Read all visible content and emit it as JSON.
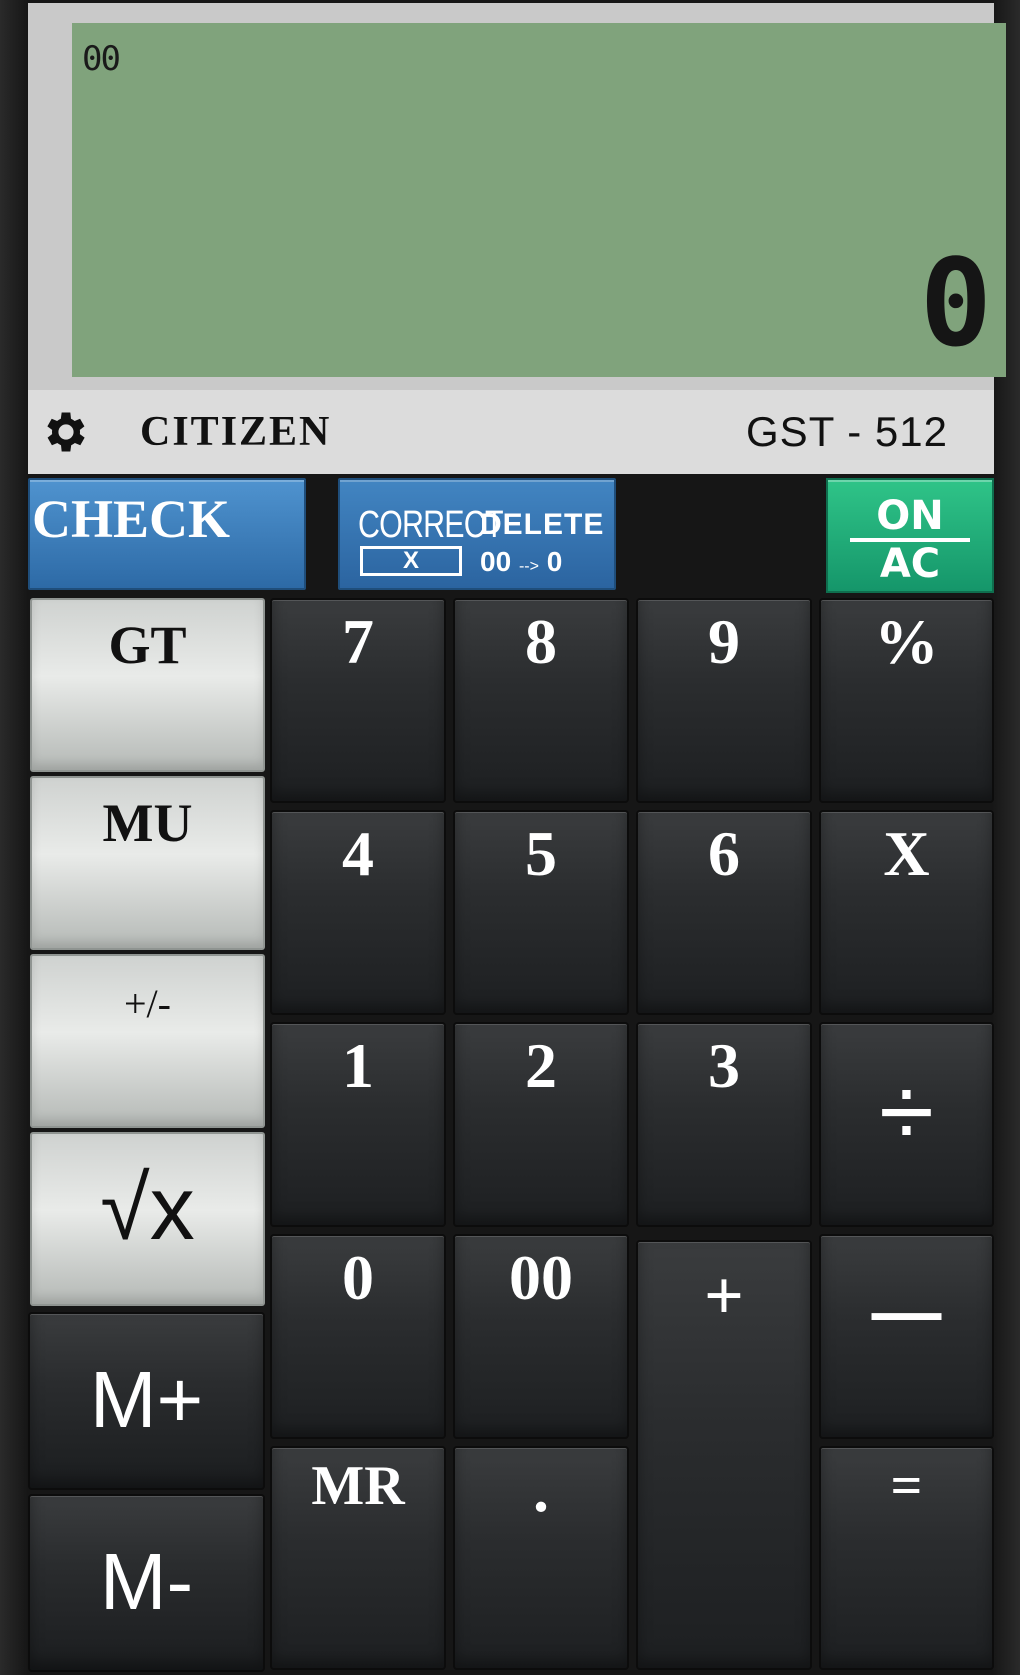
{
  "display": {
    "indicator": "00",
    "value": "0",
    "lcd_color": "#80a37c"
  },
  "brand_bar": {
    "settings_icon": "gear-icon",
    "brand": "CITIZEN",
    "model": "GST - 512"
  },
  "top_row": {
    "check": "CHECK",
    "correct": "CORRECT",
    "correct_box": "X",
    "delete": "DELETE",
    "delete_sub_left": "00",
    "delete_sub_arrow": "-->",
    "delete_sub_right": "0",
    "on": "ON",
    "ac": "AC"
  },
  "function_keys": {
    "gt": "GT",
    "mu": "MU",
    "plus_minus": "+/-",
    "sqrt": "√x",
    "m_plus": "M+",
    "m_minus": "M-"
  },
  "keys": {
    "k7": "7",
    "k8": "8",
    "k9": "9",
    "percent": "%",
    "k4": "4",
    "k5": "5",
    "k6": "6",
    "multiply": "X",
    "k1": "1",
    "k2": "2",
    "k3": "3",
    "divide": "÷",
    "k0": "0",
    "k00": "00",
    "plus": "+",
    "minus": "—",
    "mr": "MR",
    "dot": ".",
    "equals": "="
  },
  "colors": {
    "check_blue": "#3a7fbf",
    "on_green": "#1fae76",
    "key_dark": "#2b2d2f",
    "key_grey": "#dcdedc"
  }
}
